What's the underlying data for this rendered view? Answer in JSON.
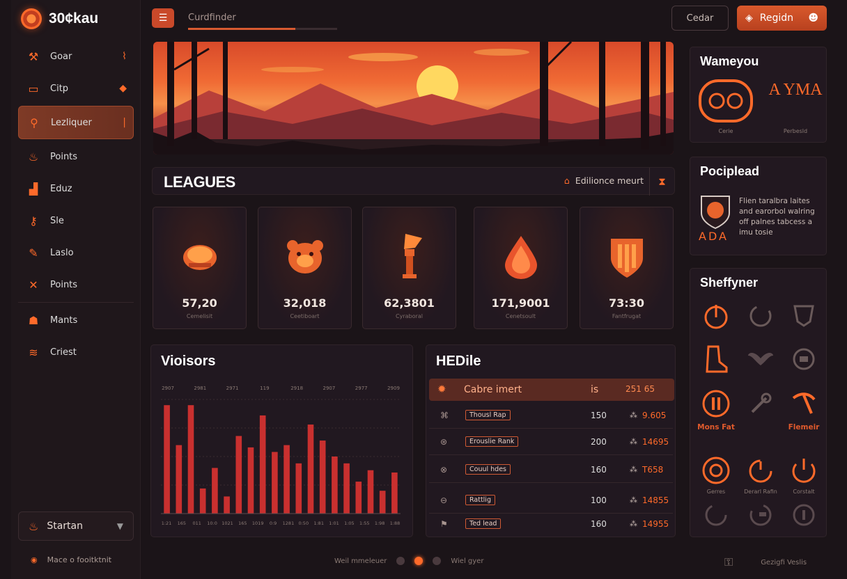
{
  "app": {
    "logo_text": "30¢kau"
  },
  "sidebar": {
    "items": [
      {
        "label": "Goar",
        "icon": "wrench-icon"
      },
      {
        "label": "Citp",
        "icon": "folder-icon"
      },
      {
        "label": "Lezliquer",
        "icon": "search-icon",
        "active": true
      },
      {
        "label": "Points",
        "icon": "flame-icon"
      },
      {
        "label": "Eduz",
        "icon": "bar-chart-icon"
      },
      {
        "label": "Sle",
        "icon": "key-icon"
      },
      {
        "label": "Laslo",
        "icon": "pencil-icon"
      },
      {
        "label": "Points",
        "icon": "close-icon"
      },
      {
        "label": "Mants",
        "icon": "people-icon"
      },
      {
        "label": "Criest",
        "icon": "wifi-icon"
      }
    ],
    "starter_label": "Startan",
    "footer_text": "Mace o fooitktnit"
  },
  "topbar": {
    "search_label": "Curdfinder",
    "search_progress": 0.72,
    "outline_button": "Cedar",
    "fill_button": "Regidn"
  },
  "leagues": {
    "title": "LEAGUES",
    "meta_label": "Edilionce meurt"
  },
  "cards": [
    {
      "value": "57,20",
      "sub": "Cemelisit",
      "icon": "helmet-icon"
    },
    {
      "value": "32,018",
      "sub": "Ceetiboart",
      "icon": "bear-icon"
    },
    {
      "value": "62,3801",
      "sub": "Cyraboral",
      "icon": "torch-icon"
    },
    {
      "value": "171,9001",
      "sub": "Cenetsoult",
      "icon": "drop-icon"
    },
    {
      "value": "73:30",
      "sub": "Fantfrugat",
      "icon": "shield-icon"
    }
  ],
  "visitors": {
    "title": "Vioisors",
    "chart_data": {
      "type": "bar",
      "top_labels": [
        "2907",
        "2981",
        "2971",
        "119",
        "2918",
        "2907",
        "2977",
        "2909"
      ],
      "x_labels": [
        "1:21",
        "165",
        "011",
        "10:0",
        "1021",
        "165",
        "1019",
        "0:9",
        "1281",
        "0:50",
        "1:81",
        "1:01",
        "1:05",
        "1:55",
        "1:98",
        "1:88"
      ],
      "values": [
        95,
        60,
        95,
        22,
        40,
        15,
        68,
        58,
        86,
        54,
        60,
        44,
        78,
        64,
        50,
        44,
        28,
        38,
        20,
        36
      ],
      "colors": {
        "bar": "#c9302f",
        "bar_top": "#e2413c"
      }
    }
  },
  "table": {
    "title": "HEDile",
    "header": {
      "label": "Cabre imert",
      "is": "is",
      "value": "251 65"
    },
    "rows": [
      {
        "tag": "Thousl Rap",
        "num": "150",
        "val": "9.605"
      },
      {
        "tag": "Erouslie Rank",
        "num": "200",
        "val": "14695"
      },
      {
        "tag": "Couul hdes",
        "num": "160",
        "val": "T658"
      },
      {
        "tag": "Rattlig",
        "num": "100",
        "val": "14855"
      },
      {
        "tag": "Ted lead",
        "num": "160",
        "val": "14955"
      }
    ]
  },
  "right": {
    "panel1": {
      "title": "Wameyou",
      "cap1": "Cerie",
      "cap2": "Perbesld",
      "logo_text": "A YMA"
    },
    "panel2": {
      "title": "Pociplead",
      "body": "Flien taralbra laites and earorbol walring off palnes tabcess a imu tosie",
      "logo_text": "ADA"
    },
    "panel3": {
      "title": "Sheffyner",
      "cap_a": "Mons Fat",
      "cap_b": "Flemeir",
      "cap_c": "Gerres",
      "cap_d": "Derarl Rafin",
      "cap_e": "Corstalt"
    }
  },
  "footer": {
    "left_text": "Weil mmeleuer",
    "mid_text": "Wiel gyer",
    "right_text": "Gezigfi Veslis"
  },
  "colors": {
    "accent": "#ff6a2a",
    "bg": "#1b1418",
    "panel": "#211820"
  }
}
